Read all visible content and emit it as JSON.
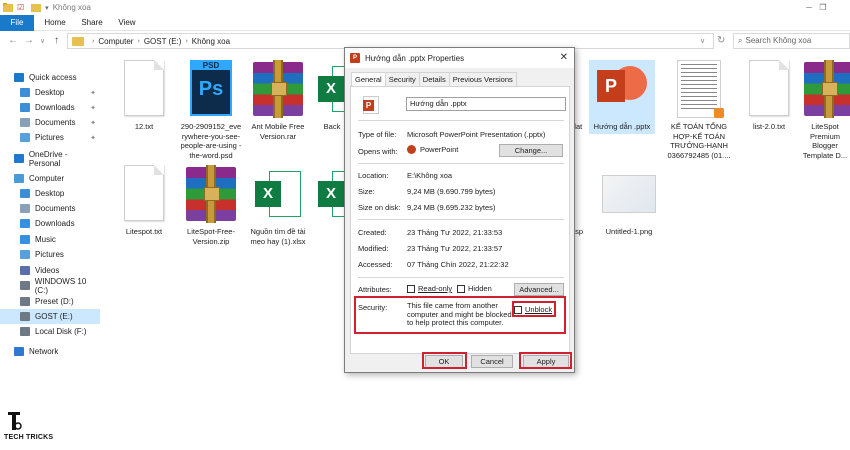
{
  "window": {
    "title": "Không xoa"
  },
  "ribbon": {
    "tabs": [
      "File",
      "Home",
      "Share",
      "View"
    ]
  },
  "address": {
    "crumbs": [
      "Computer",
      "GOST (E:)",
      "Không xoa"
    ],
    "search_placeholder": "Search Không xoa"
  },
  "sidebar": {
    "items": [
      {
        "label": "Quick access",
        "icon": "star-icon",
        "color": "#1979ca"
      },
      {
        "label": "Desktop",
        "icon": "desktop-icon",
        "color": "#3a8fd8",
        "pinned": true
      },
      {
        "label": "Downloads",
        "icon": "download-icon",
        "color": "#3a8fd8",
        "pinned": true
      },
      {
        "label": "Documents",
        "icon": "documents-icon",
        "color": "#8aa0b6",
        "pinned": true
      },
      {
        "label": "Pictures",
        "icon": "pictures-icon",
        "color": "#5aa0d8",
        "pinned": true
      },
      {
        "label": "OneDrive - Personal",
        "icon": "cloud-icon",
        "color": "#1f77d0"
      },
      {
        "label": "Computer",
        "icon": "computer-icon",
        "color": "#4b9bd8"
      },
      {
        "label": "Desktop",
        "icon": "desktop-icon",
        "color": "#3a8fd8"
      },
      {
        "label": "Documents",
        "icon": "documents-icon",
        "color": "#8aa0b6"
      },
      {
        "label": "Downloads",
        "icon": "download-icon",
        "color": "#3a8fd8"
      },
      {
        "label": "Music",
        "icon": "music-icon",
        "color": "#3a8fd8"
      },
      {
        "label": "Pictures",
        "icon": "pictures-icon",
        "color": "#5aa0d8"
      },
      {
        "label": "Videos",
        "icon": "videos-icon",
        "color": "#5a6fa8"
      },
      {
        "label": "WINDOWS 10 (C:)",
        "icon": "drive-icon",
        "color": "#6d7a86"
      },
      {
        "label": "Preset (D:)",
        "icon": "drive-icon",
        "color": "#6d7a86"
      },
      {
        "label": "GOST (E:)",
        "icon": "drive-icon",
        "color": "#6d7a86",
        "selected": true
      },
      {
        "label": "Local Disk (F:)",
        "icon": "drive-icon",
        "color": "#6d7a86"
      },
      {
        "label": "Network",
        "icon": "network-icon",
        "color": "#2f7ad0"
      }
    ]
  },
  "files": [
    {
      "label": "12.txt",
      "type": "txt"
    },
    {
      "label": "290-2909152_everywhere-you-see-people-are-using-the-word.psd",
      "type": "psd",
      "display": "290-2909152_eve rywhere-you-see- people-are-using -the-word.psd"
    },
    {
      "label": "Ant Mobile Free Version.rar",
      "type": "rar"
    },
    {
      "label": "Back",
      "type": "xls"
    },
    {
      "label": "dat",
      "type": "partial"
    },
    {
      "label": "Hướng dẫn .pptx",
      "type": "ppt",
      "selected": true
    },
    {
      "label": "KẾ TOÁN TỔNG HỢP-KẾ TOÁN TRƯỞNG-HẠNH 0366792485 (01....",
      "type": "doc"
    },
    {
      "label": "list-2.0.txt",
      "type": "txt"
    },
    {
      "label": "LiteSpot Premium Blogger Template D...",
      "type": "rar"
    },
    {
      "label": "Litespot.txt",
      "type": "txt"
    },
    {
      "label": "LiteSpot-Free-Version.zip",
      "type": "rar"
    },
    {
      "label": "Nguồn tìm đề tài mẹo hay (1).xlsx",
      "type": "xls"
    },
    {
      "label": "",
      "type": "xls"
    },
    {
      "label": "gsp",
      "type": "partial"
    },
    {
      "label": "Untitled-1.png",
      "type": "png"
    }
  ],
  "dialog": {
    "title": "Hướng dẫn .pptx Properties",
    "tabs": [
      "General",
      "Security",
      "Details",
      "Previous Versions"
    ],
    "file_name": "Hướng dẫn .pptx",
    "type_label": "Type of file:",
    "type_value": "Microsoft PowerPoint Presentation (.pptx)",
    "opens_label": "Opens with:",
    "opens_value": "PowerPoint",
    "change_button": "Change...",
    "location_label": "Location:",
    "location_value": "E:\\Không xoa",
    "size_label": "Size:",
    "size_value": "9,24 MB (9.690.799 bytes)",
    "size_disk_label": "Size on disk:",
    "size_disk_value": "9,24 MB (9.695.232 bytes)",
    "created_label": "Created:",
    "created_value": "23 Tháng Tư 2022, 21:33:53",
    "modified_label": "Modified:",
    "modified_value": "23 Tháng Tư 2022, 21:33:57",
    "accessed_label": "Accessed:",
    "accessed_value": "07 Tháng Chín 2022, 21:22:32",
    "attributes_label": "Attributes:",
    "readonly_label": "Read-only",
    "hidden_label": "Hidden",
    "advanced_button": "Advanced...",
    "security_label": "Security:",
    "security_text": "This file came from another computer and might be blocked to help protect this computer.",
    "unblock_label": "Unblock",
    "ok_button": "OK",
    "cancel_button": "Cancel",
    "apply_button": "Apply",
    "highlight_color": "#d1202f"
  },
  "watermark": {
    "brand": "TECH TRICKS"
  }
}
